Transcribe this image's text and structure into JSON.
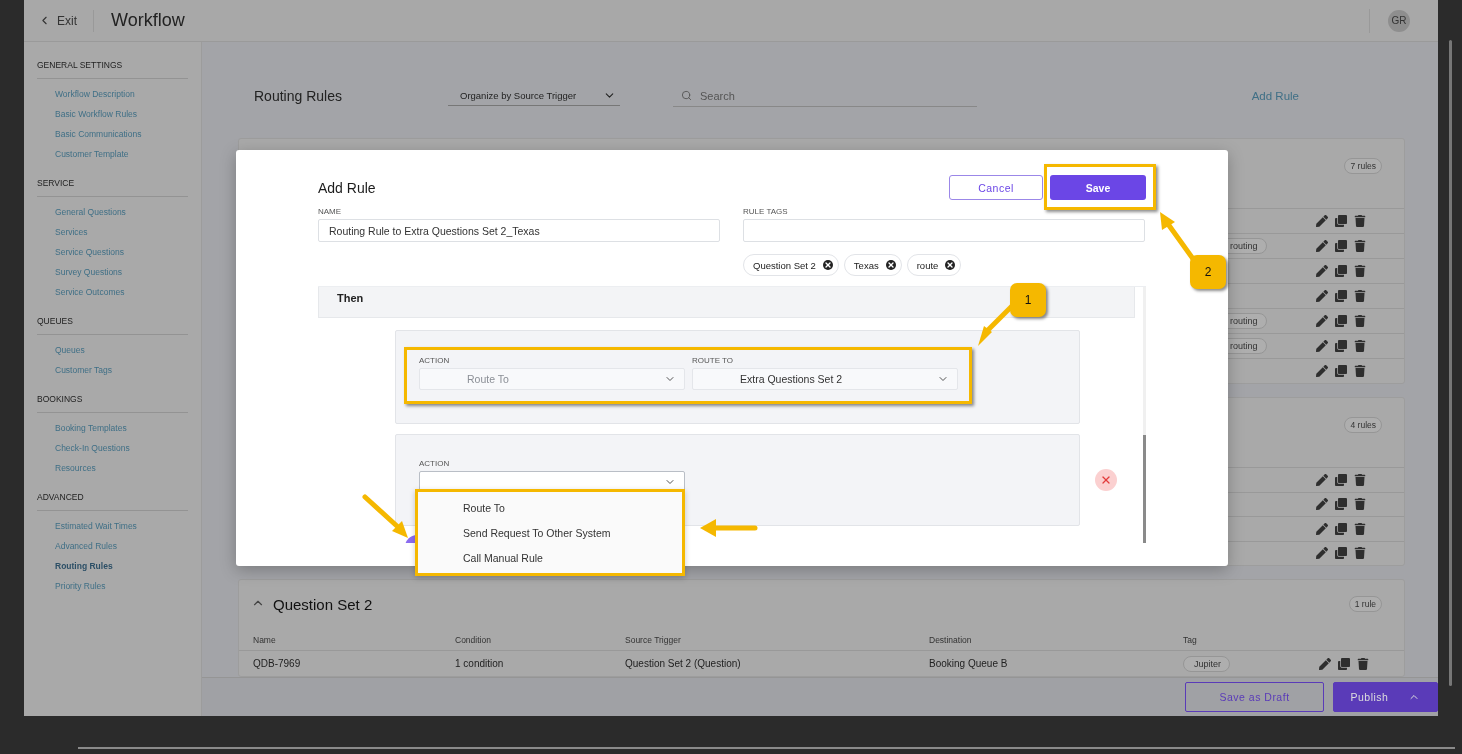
{
  "top_bar": {
    "back_label": "Exit",
    "title": "Workflow",
    "avatar": "GR"
  },
  "sidebar": {
    "sections": [
      {
        "heading": "GENERAL SETTINGS",
        "items": [
          {
            "label": "Workflow Description",
            "selected": false
          },
          {
            "label": "Basic Workflow Rules",
            "selected": false
          },
          {
            "label": "Basic Communications",
            "selected": false
          },
          {
            "label": "Customer Template",
            "selected": false
          }
        ]
      },
      {
        "heading": "SERVICE",
        "items": [
          {
            "label": "General Questions",
            "selected": false
          },
          {
            "label": "Services",
            "selected": false
          },
          {
            "label": "Service Questions",
            "selected": false
          },
          {
            "label": "Survey Questions",
            "selected": false
          },
          {
            "label": "Service Outcomes",
            "selected": false
          }
        ]
      },
      {
        "heading": "QUEUES",
        "items": [
          {
            "label": "Queues",
            "selected": false
          },
          {
            "label": "Customer Tags",
            "selected": false
          }
        ]
      },
      {
        "heading": "BOOKINGS",
        "items": [
          {
            "label": "Booking Templates",
            "selected": false
          },
          {
            "label": "Check-In Questions",
            "selected": false
          },
          {
            "label": "Resources",
            "selected": false
          }
        ]
      },
      {
        "heading": "ADVANCED",
        "items": [
          {
            "label": "Estimated Wait Times",
            "selected": false
          },
          {
            "label": "Advanced Rules",
            "selected": false
          },
          {
            "label": "Routing Rules",
            "selected": true
          },
          {
            "label": "Priority Rules",
            "selected": false
          }
        ]
      }
    ]
  },
  "page": {
    "title": "Routing Rules",
    "organize_select": "Organize by Source Trigger",
    "search": {
      "placeholder": "Search"
    },
    "add_rule": "Add Rule"
  },
  "rule_groups": [
    {
      "count": "7 rules",
      "rows": [
        {},
        {
          "tag": "routing"
        },
        {},
        {},
        {
          "tag": "routing"
        },
        {
          "tag": "routing"
        },
        {}
      ]
    },
    {
      "count": "4 rules",
      "rows": [
        {},
        {},
        {},
        {}
      ]
    },
    {
      "title": "Question Set 2",
      "expanded": true,
      "count": "1 rule",
      "columns": [
        "Name",
        "Condition",
        "Source Trigger",
        "Destination",
        "Tag"
      ],
      "rows": [
        {
          "cells": [
            "QDB-7969",
            "1 condition",
            "Question Set 2 (Question)",
            "Booking Queue B"
          ],
          "tag": "Jupiter"
        }
      ]
    }
  ],
  "footer": {
    "buttons": [
      "Save as Draft",
      "Publish"
    ]
  },
  "modal": {
    "title": "Add Rule",
    "cancel": "Cancel",
    "save": "Save",
    "name": {
      "label": "NAME",
      "value": "Routing Rule to Extra Questions Set 2_Texas"
    },
    "tags": {
      "label": "RULE TAGS",
      "chips": [
        "Question Set 2",
        "Texas",
        "route"
      ]
    },
    "then_label": "Then",
    "actions": [
      {
        "removable": false,
        "fields": [
          {
            "label": "ACTION",
            "value": "Route To",
            "disabled": true
          },
          {
            "label": "ROUTE TO",
            "value": "Extra Questions Set 2",
            "disabled": false
          }
        ]
      },
      {
        "removable": true,
        "fields": [
          {
            "label": "ACTION",
            "open": true,
            "options": [
              "Route To",
              "Send Request To Other System",
              "Call Manual Rule"
            ]
          }
        ]
      }
    ]
  },
  "annotations": {
    "callouts": [
      "1",
      "2"
    ]
  }
}
